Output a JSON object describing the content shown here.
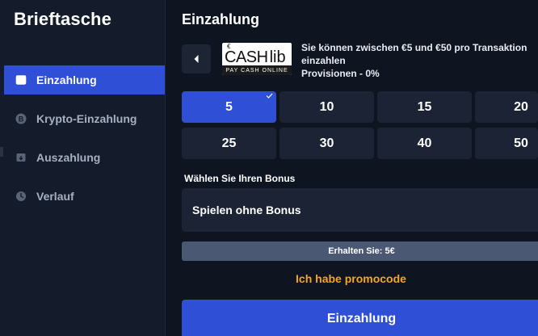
{
  "sidebar": {
    "title": "Brieftasche",
    "items": [
      {
        "label": "Einzahlung",
        "icon": "deposit-icon",
        "active": true
      },
      {
        "label": "Krypto-Einzahlung",
        "icon": "bitcoin-icon",
        "active": false
      },
      {
        "label": "Auszahlung",
        "icon": "withdraw-icon",
        "active": false
      },
      {
        "label": "Verlauf",
        "icon": "history-icon",
        "active": false
      }
    ]
  },
  "main": {
    "title": "Einzahlung",
    "back_icon": "chevron-left-icon",
    "provider": {
      "logo_text_cash": "CASH",
      "logo_text_lib": "lib",
      "logo_euro": "€",
      "logo_subtitle": "PAY CASH ONLINE",
      "info_line1": "Sie können zwischen €5 und €50 pro Transaktion einzahlen",
      "info_line2": "Provisionen - 0%"
    },
    "amounts": [
      "5",
      "10",
      "15",
      "20",
      "25",
      "30",
      "40",
      "50"
    ],
    "selected_amount": "5",
    "bonus_label": "Wählen Sie Ihren Bonus",
    "bonus_value": "Spielen ohne Bonus",
    "receive_text": "Erhalten Sie: 5€",
    "promo_link": "Ich habe promocode",
    "submit_label": "Einzahlung"
  },
  "colors": {
    "accent": "#2e4fd6",
    "promo": "#f5a623",
    "background": "#0e1521",
    "sidebar": "#141c2b",
    "tile": "#1b2334"
  }
}
